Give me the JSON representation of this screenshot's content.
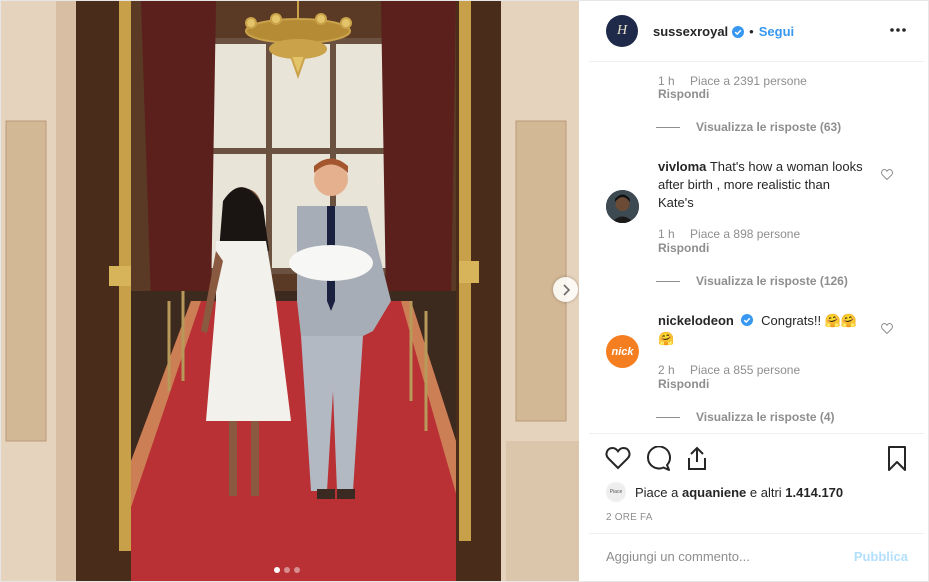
{
  "post": {
    "photo_alt": "",
    "carousel_dots": 3,
    "active_dot": 0
  },
  "header": {
    "username": "sussexroyal",
    "separator": "•",
    "follow_label": "Segui",
    "avatar_letter": "H"
  },
  "comments": [
    {
      "username": "",
      "text": "",
      "time": "1 h",
      "likes": "Piace a 2391 persone",
      "reply": "Rispondi",
      "view_replies": "Visualizza le risposte (63)"
    },
    {
      "username": "vivloma",
      "text": "That's how a woman looks after birth , more realistic than Kate's",
      "time": "1 h",
      "likes": "Piace a 898 persone",
      "reply": "Rispondi",
      "view_replies": "Visualizza le risposte (126)"
    },
    {
      "username": "nickelodeon",
      "text": "Congrats!! 🤗🤗 🤗",
      "time": "2 h",
      "likes": "Piace a 855 persone",
      "reply": "Rispondi",
      "view_replies": "Visualizza le risposte (4)",
      "avatar_text": "nick"
    }
  ],
  "actions": {
    "icons": [
      "heart-icon",
      "comment-icon",
      "share-icon",
      "bookmark-icon"
    ],
    "liked_by_prefix": "Piace a ",
    "liked_by_user": "aquaniene",
    "liked_by_suffix": " e altri ",
    "liked_by_count": "1.414.170",
    "liked_by_mini": "Piace",
    "date": "2 ORE FA"
  },
  "add_comment": {
    "placeholder": "Aggiungi un commento...",
    "publish_label": "Pubblica"
  },
  "colors": {
    "accent": "#3897f0",
    "publish_disabled": "#b2dffc",
    "muted": "#8e8e8e",
    "nick_orange": "#f57f20"
  }
}
